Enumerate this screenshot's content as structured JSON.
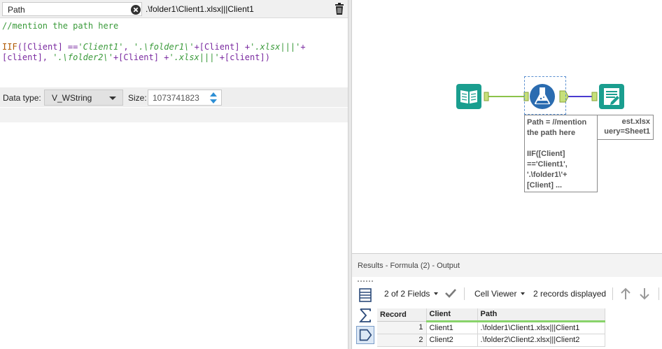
{
  "formula_panel": {
    "field_name": "Path",
    "preview_value": ".\\folder1\\Client1.xlsx|||Client1",
    "expression_comment": "//mention the path here",
    "expression_line1": {
      "fn": "IIF",
      "p1": "([Client] ==",
      "s1": "'Client1'",
      "p2": ", ",
      "s2": "'.\\folder1\\'",
      "p3": "+[Client] +",
      "s3": "'.xlsx|||'",
      "p4": "+"
    },
    "expression_line2": {
      "p1": "[client], ",
      "s1": "'.\\folder2\\'",
      "p2": "+[Client] +",
      "s2": "'.xlsx|||'",
      "p3": "+[client])"
    },
    "data_type_label": "Data type:",
    "data_type_value": "V_WString",
    "size_label": "Size:",
    "size_value": "1073741823"
  },
  "canvas": {
    "output_annotation_line1": "est.xlsx",
    "output_annotation_line2": "uery=Sheet1",
    "formula_annotation": {
      "line1": "Path = //mention",
      "line2": "the path here",
      "line3": "",
      "line4": "IIF([Client]",
      "line5": "=='Client1',",
      "line6": "'.\\folder1\\'+",
      "line7": "[Client] ..."
    }
  },
  "results": {
    "title": "Results - Formula (2) - Output",
    "fields_count": "2 of 2 Fields",
    "cell_viewer": "Cell Viewer",
    "records_displayed": "2 records displayed",
    "columns": [
      "Record",
      "Client",
      "Path"
    ],
    "rows": [
      {
        "record": "1",
        "client": "Client1",
        "path": ".\\folder1\\Client1.xlsx|||Client1"
      },
      {
        "record": "2",
        "client": "Client2",
        "path": ".\\folder2\\Client2.xlsx|||Client2"
      }
    ]
  },
  "colors": {
    "tool_teal": "#1a9e8f",
    "tool_blue": "#2b6cb0",
    "connector_green": "#8bc34a",
    "connector_blue": "#4a3bd0",
    "selection_dashed": "#5a8fd0",
    "grid_header_accent": "#88d36a"
  },
  "icons": {
    "clear": "clear-circle-x-icon",
    "delete": "trash-icon",
    "input": "book-input-icon",
    "formula": "flask-formula-icon",
    "output": "document-output-icon",
    "check": "checkmark-icon",
    "up": "arrow-up-icon",
    "down": "arrow-down-icon"
  }
}
